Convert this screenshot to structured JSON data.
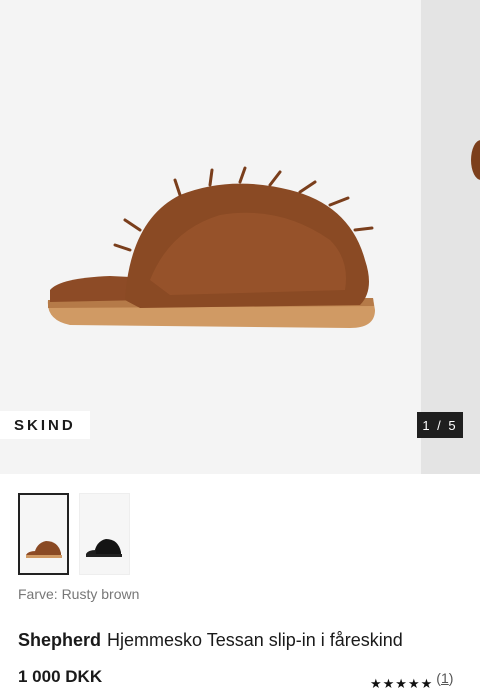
{
  "gallery": {
    "material_badge": "SKIND",
    "counter": "1 / 5",
    "current_index": 1,
    "total_images": 5
  },
  "thumbnails": [
    {
      "name": "Rusty brown",
      "color": "#8a4a24",
      "selected": true
    },
    {
      "name": "Black",
      "color": "#141414",
      "selected": false
    }
  ],
  "variant": {
    "label": "Farve: Rusty brown"
  },
  "product": {
    "brand": "Shepherd",
    "name": "Hjemmesko Tessan slip-in i fåreskind",
    "price": "1 000 DKK"
  },
  "rating": {
    "stars": "★★★★★",
    "value": 5,
    "count_open": "(",
    "count": "1",
    "count_close": ")"
  },
  "colors": {
    "fur": "#8a4a24",
    "sole": "#d09a64",
    "badge_bg": "#1f1f1f"
  }
}
